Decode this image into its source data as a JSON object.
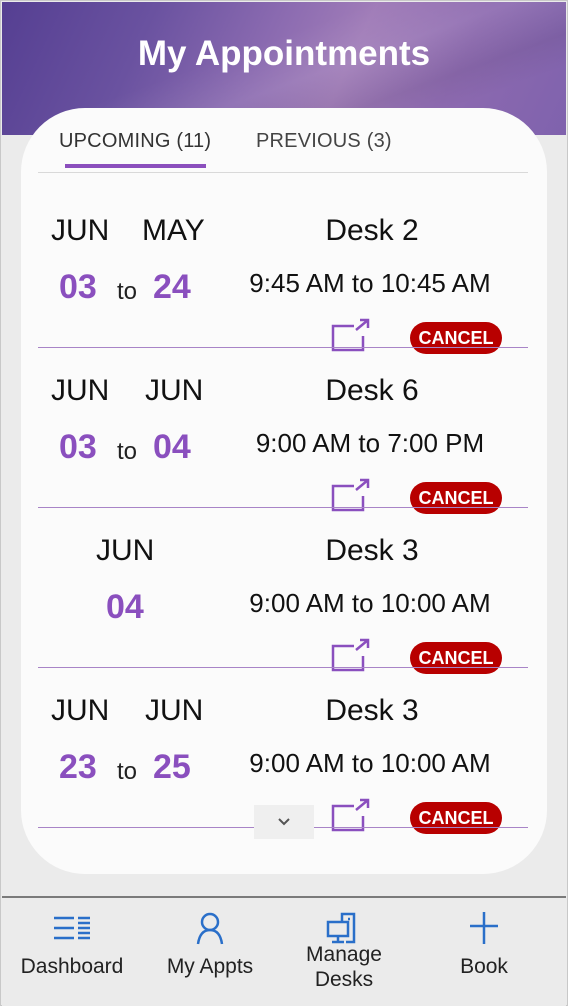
{
  "header": {
    "title": "My Appointments"
  },
  "tabs": [
    {
      "label": "UPCOMING (11)",
      "active": true
    },
    {
      "label": "PREVIOUS (3)",
      "active": false
    }
  ],
  "appointments": [
    {
      "start_month": "JUN",
      "end_month": "MAY",
      "start_day": "03",
      "end_day": "24",
      "to": "to",
      "desk": "Desk 2",
      "time": "9:45 AM to 10:45 AM",
      "cancel_label": "CANCEL"
    },
    {
      "start_month": "JUN",
      "end_month": "JUN",
      "start_day": "03",
      "end_day": "04",
      "to": "to",
      "desk": "Desk 6",
      "time": "9:00 AM to 7:00 PM",
      "cancel_label": "CANCEL"
    },
    {
      "start_month": "JUN",
      "start_day": "04",
      "desk": "Desk 3",
      "time": "9:00 AM to 10:00 AM",
      "cancel_label": "CANCEL"
    },
    {
      "start_month": "JUN",
      "end_month": "JUN",
      "start_day": "23",
      "end_day": "25",
      "to": "to",
      "desk": "Desk 3",
      "time": "9:00 AM to 10:00 AM",
      "cancel_label": "CANCEL"
    }
  ],
  "nav": [
    {
      "label": "Dashboard",
      "icon": "dashboard-list-icon"
    },
    {
      "label": "My Appts",
      "icon": "person-icon"
    },
    {
      "label": "Manage Desks",
      "line1": "Manage",
      "line2": "Desks",
      "icon": "desk-computer-icon"
    },
    {
      "label": "Book",
      "icon": "plus-icon"
    }
  ],
  "colors": {
    "accent": "#8a4fbe",
    "cancel": "#b80000",
    "nav_icon": "#2a6fc9"
  }
}
